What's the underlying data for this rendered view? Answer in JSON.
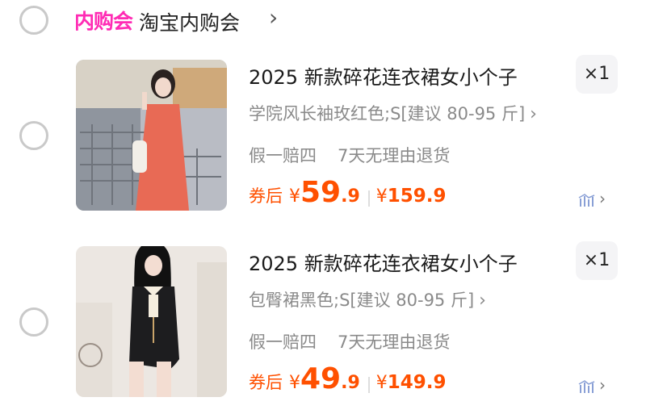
{
  "store": {
    "badge": "内购会",
    "name": "淘宝内购会",
    "chevron": "›"
  },
  "items": [
    {
      "title": "2025 新款碎花连衣裙女小个子",
      "quantity": "×1",
      "variant": "学院风长袖玫红色;S[建议 80-95 斤]",
      "services": [
        "假一赔四",
        "7天无理由退货"
      ],
      "coupon_label": "券后",
      "currency": "¥",
      "price_int": "59",
      "price_dec": ".9",
      "original_currency": "¥",
      "original_price": "159.9",
      "dress_color": "#e86a55"
    },
    {
      "title": "2025 新款碎花连衣裙女小个子",
      "quantity": "×1",
      "variant": "包臀裙黑色;S[建议 80-95 斤]",
      "services": [
        "假一赔四",
        "7天无理由退货"
      ],
      "coupon_label": "券后",
      "currency": "¥",
      "price_int": "49",
      "price_dec": ".9",
      "original_currency": "¥",
      "original_price": "149.9",
      "dress_color": "#1d1d1f"
    }
  ],
  "icons": {
    "chevron": "›",
    "trend": "ᨗ"
  },
  "colors": {
    "accent": "#ff5000",
    "badge": "#ff2bb4",
    "muted": "#8a8a8a"
  }
}
